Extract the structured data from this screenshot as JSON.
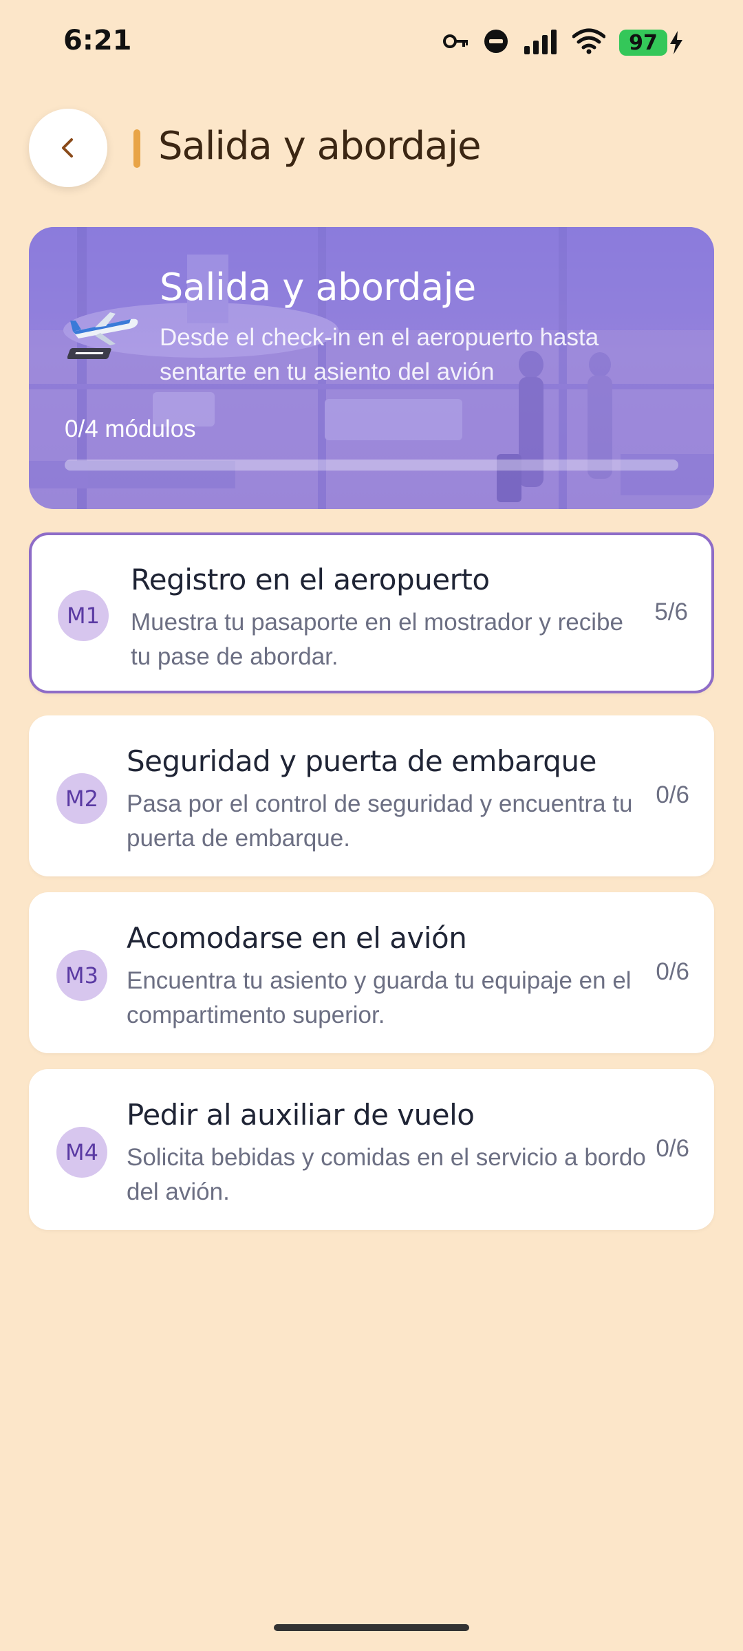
{
  "status_bar": {
    "time": "6:21",
    "battery": "97"
  },
  "header": {
    "title": "Salida y abordaje"
  },
  "hero": {
    "title": "Salida y abordaje",
    "subtitle": "Desde el check-in en el aeropuerto hasta sentarte en tu asiento del avión",
    "progress_label": "0/4 módulos",
    "progress_fraction": 0,
    "icon": "airplane-icon"
  },
  "modules": [
    {
      "badge": "M1",
      "title": "Registro en el aeropuerto",
      "description": "Muestra tu pasaporte en el mostrador y recibe tu pase de abordar.",
      "count": "5/6",
      "selected": true
    },
    {
      "badge": "M2",
      "title": "Seguridad y puerta de embarque",
      "description": "Pasa por el control de seguridad y encuentra tu puerta de embarque.",
      "count": "0/6",
      "selected": false
    },
    {
      "badge": "M3",
      "title": "Acomodarse en el avión",
      "description": "Encuentra tu asiento y guarda tu equipaje en el compartimento superior.",
      "count": "0/6",
      "selected": false
    },
    {
      "badge": "M4",
      "title": "Pedir al auxiliar de vuelo",
      "description": "Solicita bebidas y comidas en el servicio a bordo del avión.",
      "count": "0/6",
      "selected": false
    }
  ],
  "colors": {
    "background": "#fce6c9",
    "accent": "#e8a447",
    "hero": "#8c7de0",
    "selected_border": "#8e6cc7",
    "badge_bg": "#d7c6ee",
    "badge_text": "#5a3aa3"
  }
}
